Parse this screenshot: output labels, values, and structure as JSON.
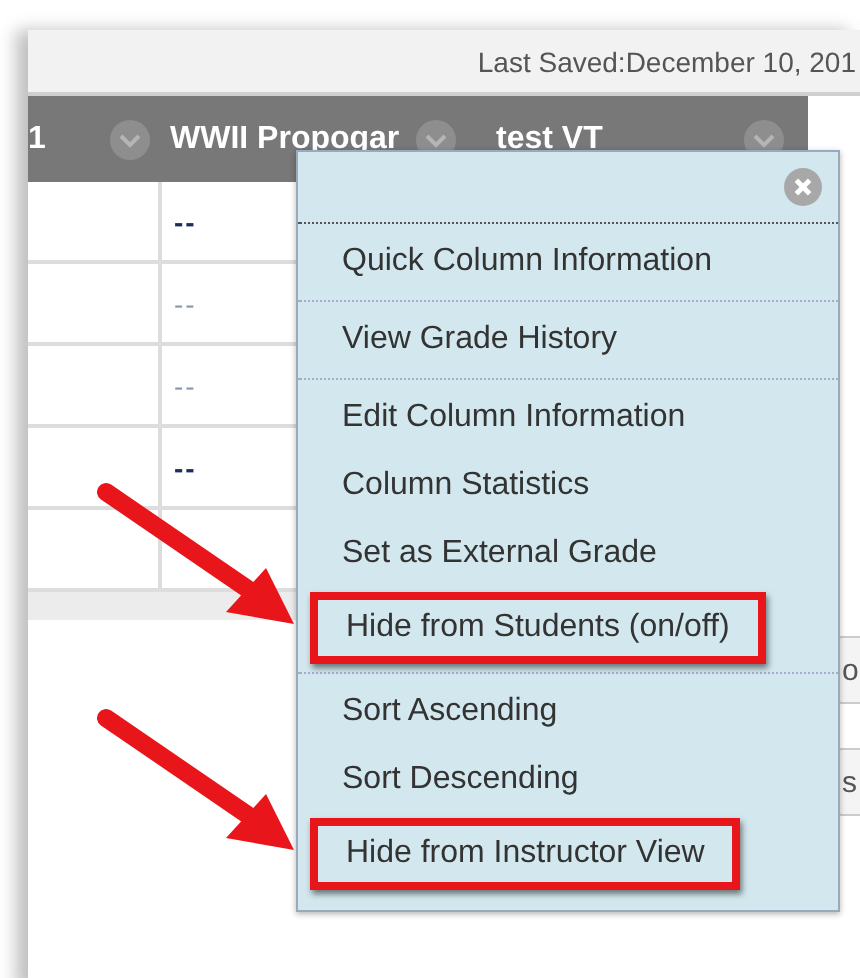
{
  "status": {
    "text": "Last Saved:December 10, 201"
  },
  "table": {
    "columns": [
      {
        "label": "1"
      },
      {
        "label": "WWII Propogar"
      },
      {
        "label": "test VT"
      }
    ],
    "rows": [
      {
        "value": "--",
        "bold": true
      },
      {
        "value": "--",
        "bold": false
      },
      {
        "value": "--",
        "bold": false
      },
      {
        "value": "--",
        "bold": true
      }
    ]
  },
  "side_buttons": [
    "o",
    "s"
  ],
  "menu": {
    "groups": [
      [
        {
          "label": "Quick Column Information",
          "highlighted": false
        }
      ],
      [
        {
          "label": "View Grade History",
          "highlighted": false
        }
      ],
      [
        {
          "label": "Edit Column Information",
          "highlighted": false
        },
        {
          "label": "Column Statistics",
          "highlighted": false
        },
        {
          "label": "Set as External Grade",
          "highlighted": false
        },
        {
          "label": "Hide from Students (on/off)",
          "highlighted": true
        }
      ],
      [
        {
          "label": "Sort Ascending",
          "highlighted": false
        },
        {
          "label": "Sort Descending",
          "highlighted": false
        },
        {
          "label": "Hide from Instructor View",
          "highlighted": true
        }
      ]
    ]
  }
}
